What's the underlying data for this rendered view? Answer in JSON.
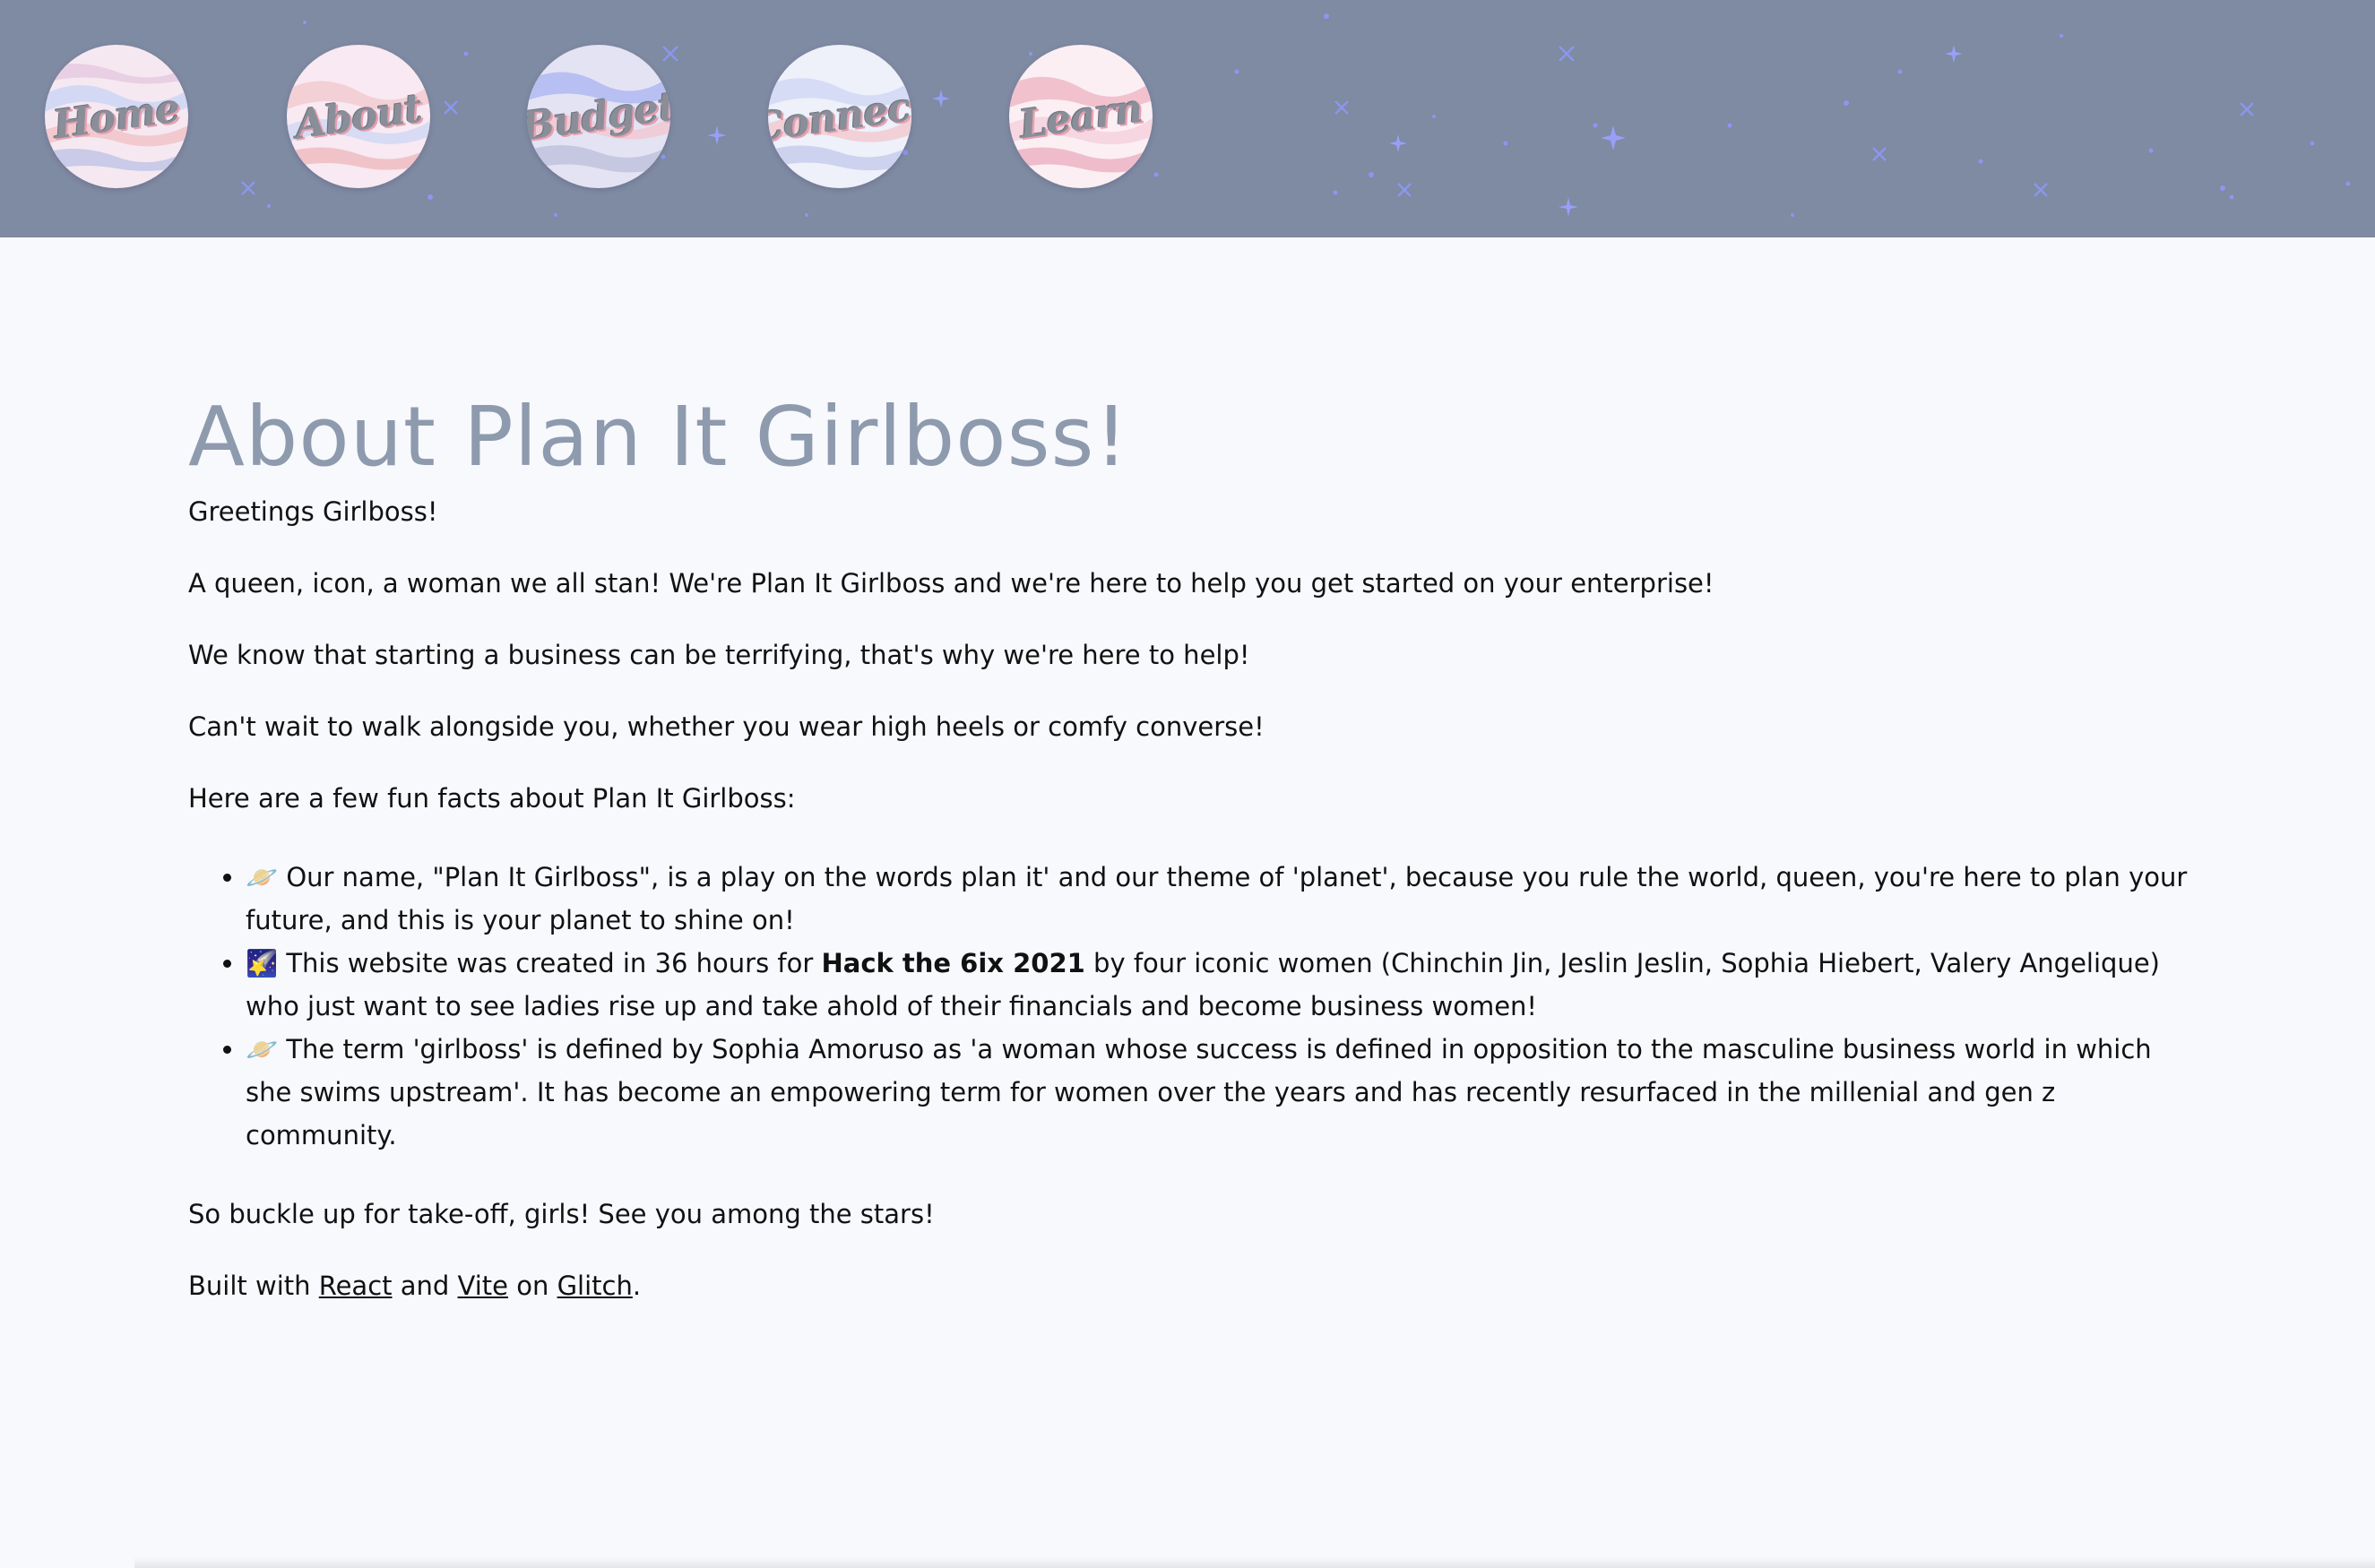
{
  "nav": {
    "items": [
      {
        "label": "Home"
      },
      {
        "label": "About"
      },
      {
        "label": "Budget"
      },
      {
        "label": "Connect"
      },
      {
        "label": "Learn"
      }
    ]
  },
  "about": {
    "title": "About Plan It Girlboss!",
    "greeting": "Greetings Girlboss!",
    "p1": "A queen, icon, a woman we all stan! We're Plan It Girlboss and we're here to help you get started on your enterprise!",
    "p2": "We know that starting a business can be terrifying, that's why we're here to help!",
    "p3": "Can't wait to walk alongside you, whether you wear high heels or comfy converse!",
    "facts_intro": "Here are a few fun facts about Plan It Girlboss:",
    "facts": [
      {
        "icon": "🪐",
        "text": " Our name, \"Plan It Girlboss\", is a play on the words plan it' and our theme of 'planet', because you rule the world, queen, you're here to plan your future, and this is your planet to shine on!"
      },
      {
        "icon": "🌠",
        "pre": " This website was created in 36 hours for ",
        "bold": "Hack the 6ix 2021",
        "post": " by four iconic women (Chinchin Jin, Jeslin Jeslin, Sophia Hiebert, Valery Angelique) who just want to see ladies rise up and take ahold of their financials and become business women!"
      },
      {
        "icon": "🪐",
        "text": " The term 'girlboss' is defined by Sophia Amoruso as 'a woman whose success is defined in opposition to the masculine business world in which she swims upstream'. It has become an empowering term for women over the years and has recently resurfaced in the millenial and gen z community."
      }
    ],
    "closing": "So buckle up for take-off, girls! See you among the stars!",
    "built": {
      "prefix": "Built with ",
      "react": "React",
      "and": " and ",
      "vite": "Vite",
      "on": " on ",
      "glitch": "Glitch",
      "suffix": "."
    }
  },
  "colors": {
    "header_bg": "#7f8aa3",
    "page_bg": "#f8f9fd",
    "title": "#8e9aad",
    "star": "#8f99ff"
  }
}
